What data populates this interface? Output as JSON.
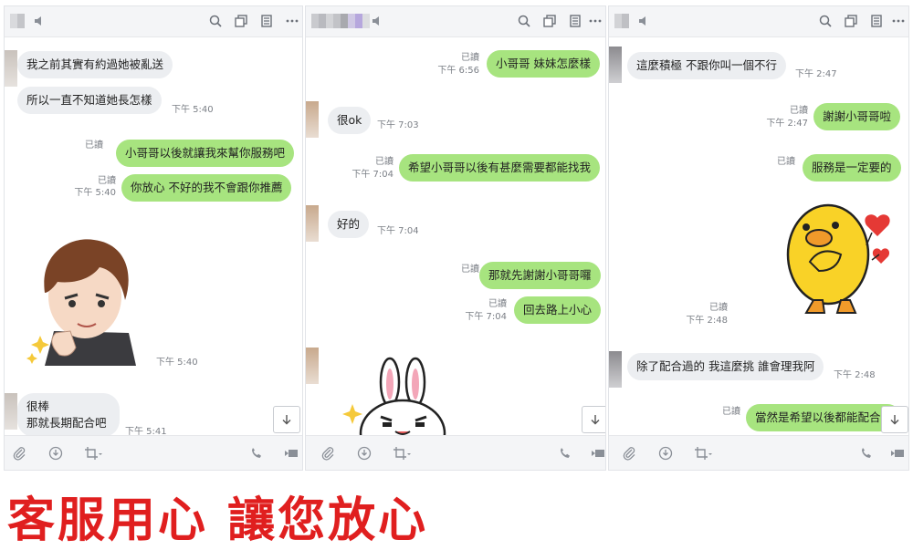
{
  "colors": {
    "accent_red": "#e01f1f",
    "bubble_out": "#a7e47f",
    "bubble_in": "#eceef1"
  },
  "icons": [
    "speaker-icon",
    "search-icon",
    "copy-icon",
    "notes-icon",
    "more-icon",
    "attach-icon",
    "download-circle-icon",
    "crop-icon",
    "phone-icon",
    "video-icon",
    "arrow-down-icon"
  ],
  "panel1": {
    "m1": "我之前其實有約過她被亂送",
    "m2": "所以一直不知道她長怎樣",
    "t2": "下午 5:40",
    "m3_read": "已讀",
    "m3": "小哥哥以後就讓我來幫你服務吧",
    "m4_read": "已讀",
    "m4_time": "下午 5:40",
    "m4": "你放心 不好的我不會跟你推薦",
    "sticker_time": "下午 5:40",
    "m5_line1": "很棒",
    "m5_line2": "那就長期配合吧",
    "t5": "下午 5:41"
  },
  "panel2": {
    "m1_read": "已讀",
    "m1_time": "下午 6:56",
    "m1": "小哥哥 妹妹怎麼樣",
    "m2": "很ok",
    "t2": "下午 7:03",
    "m3_read": "已讀",
    "m3_time": "下午 7:04",
    "m3": "希望小哥哥以後有甚麼需要都能找我",
    "m4": "好的",
    "t4": "下午 7:04",
    "m5_read": "已讀",
    "m5": "那就先謝謝小哥哥囉",
    "m6_read": "已讀",
    "m6_time": "下午 7:04",
    "m6": "回去路上小心"
  },
  "panel3": {
    "m1": "這麼積極 不跟你叫一個不行",
    "t1": "下午 2:47",
    "m2_read": "已讀",
    "m2_time": "下午 2:47",
    "m2": "謝謝小哥哥啦",
    "m3_read": "已讀",
    "m3": "服務是一定要的",
    "sticker_read": "已讀",
    "sticker_time": "下午 2:48",
    "m4": "除了配合過的 我這麼挑 誰會理我阿",
    "t4": "下午 2:48",
    "m5_read": "已讀",
    "m5": "當然是希望以後都能配合"
  },
  "slogan": "客服用心 讓您放心"
}
